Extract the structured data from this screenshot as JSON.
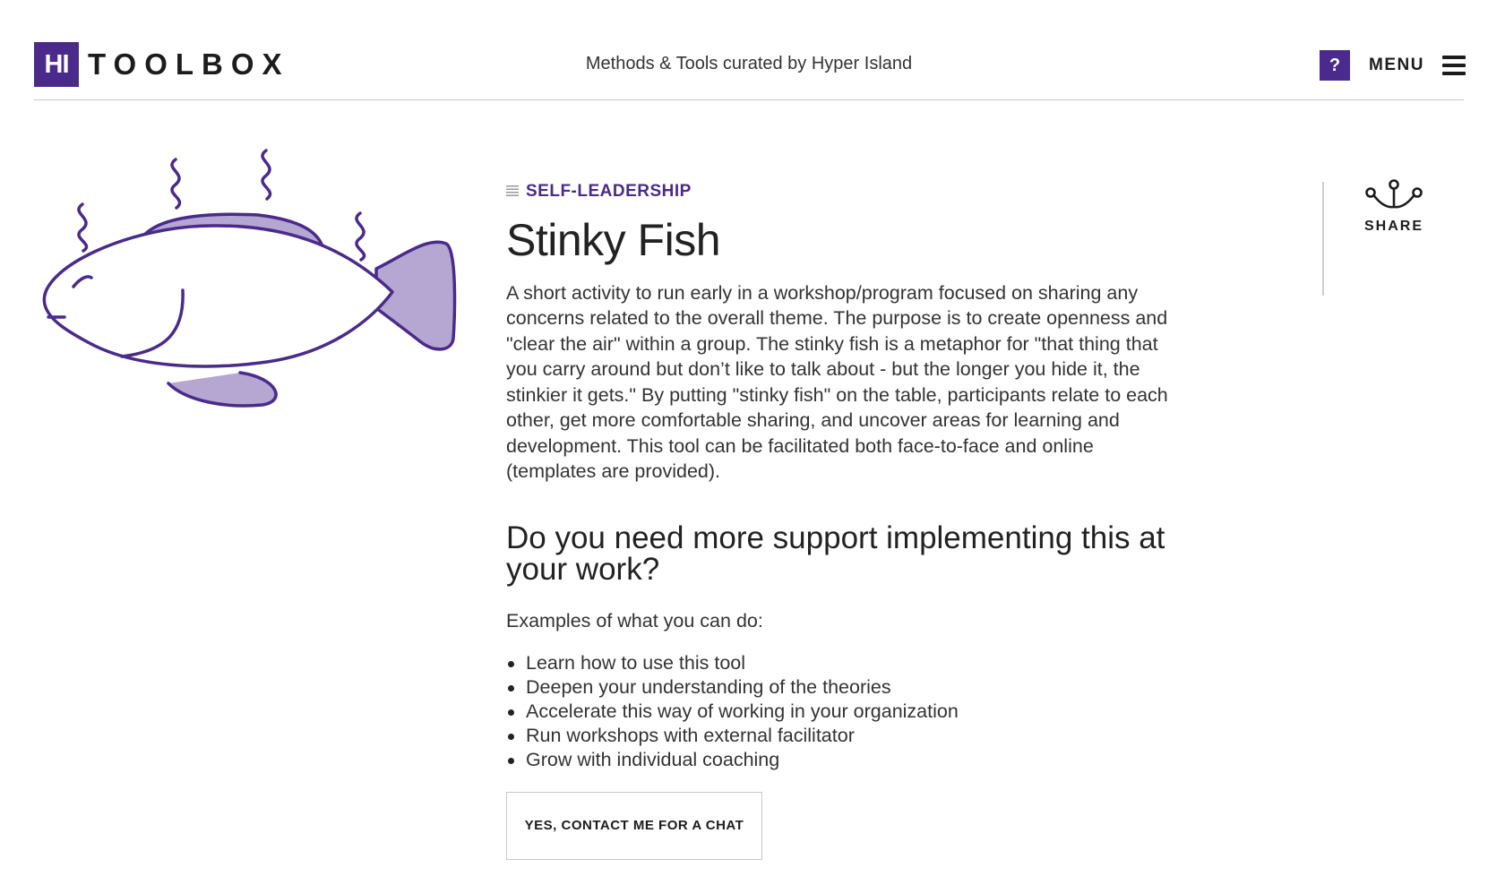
{
  "header": {
    "logo_mark": "HI",
    "logo_text": "TOOLBOX",
    "tagline": "Methods & Tools curated by Hyper Island",
    "help_label": "?",
    "menu_label": "MENU"
  },
  "tool": {
    "category": "SELF-LEADERSHIP",
    "title": "Stinky Fish",
    "description": "A short activity to run early in a workshop/program focused on sharing any concerns related to the overall theme. The purpose is to create openness and \"clear the air\" within a group. The stinky fish is a metaphor for \"that thing that you carry around but don’t like to talk about - but the longer you hide it, the stinkier it gets.\" By putting \"stinky fish\" on the table, participants relate to each other, get more comfortable sharing, and uncover areas for learning and development. This tool can be facilitated both face-to-face and online (templates are provided).",
    "illustration_icon": "stinky-fish-illustration"
  },
  "support": {
    "heading": "Do you need more support implementing this at your work?",
    "examples_label": "Examples of what you can do:",
    "examples": [
      "Learn how to use this tool",
      "Deepen your understanding of the theories",
      "Accelerate this way of working in your organization",
      "Run workshops with external facilitator",
      "Grow with individual coaching"
    ],
    "cta_label": "YES, CONTACT ME FOR A CHAT"
  },
  "share": {
    "label": "SHARE",
    "icon": "share-icon"
  },
  "colors": {
    "brand": "#4a2a8a",
    "fin_fill": "#b6a6d2"
  }
}
